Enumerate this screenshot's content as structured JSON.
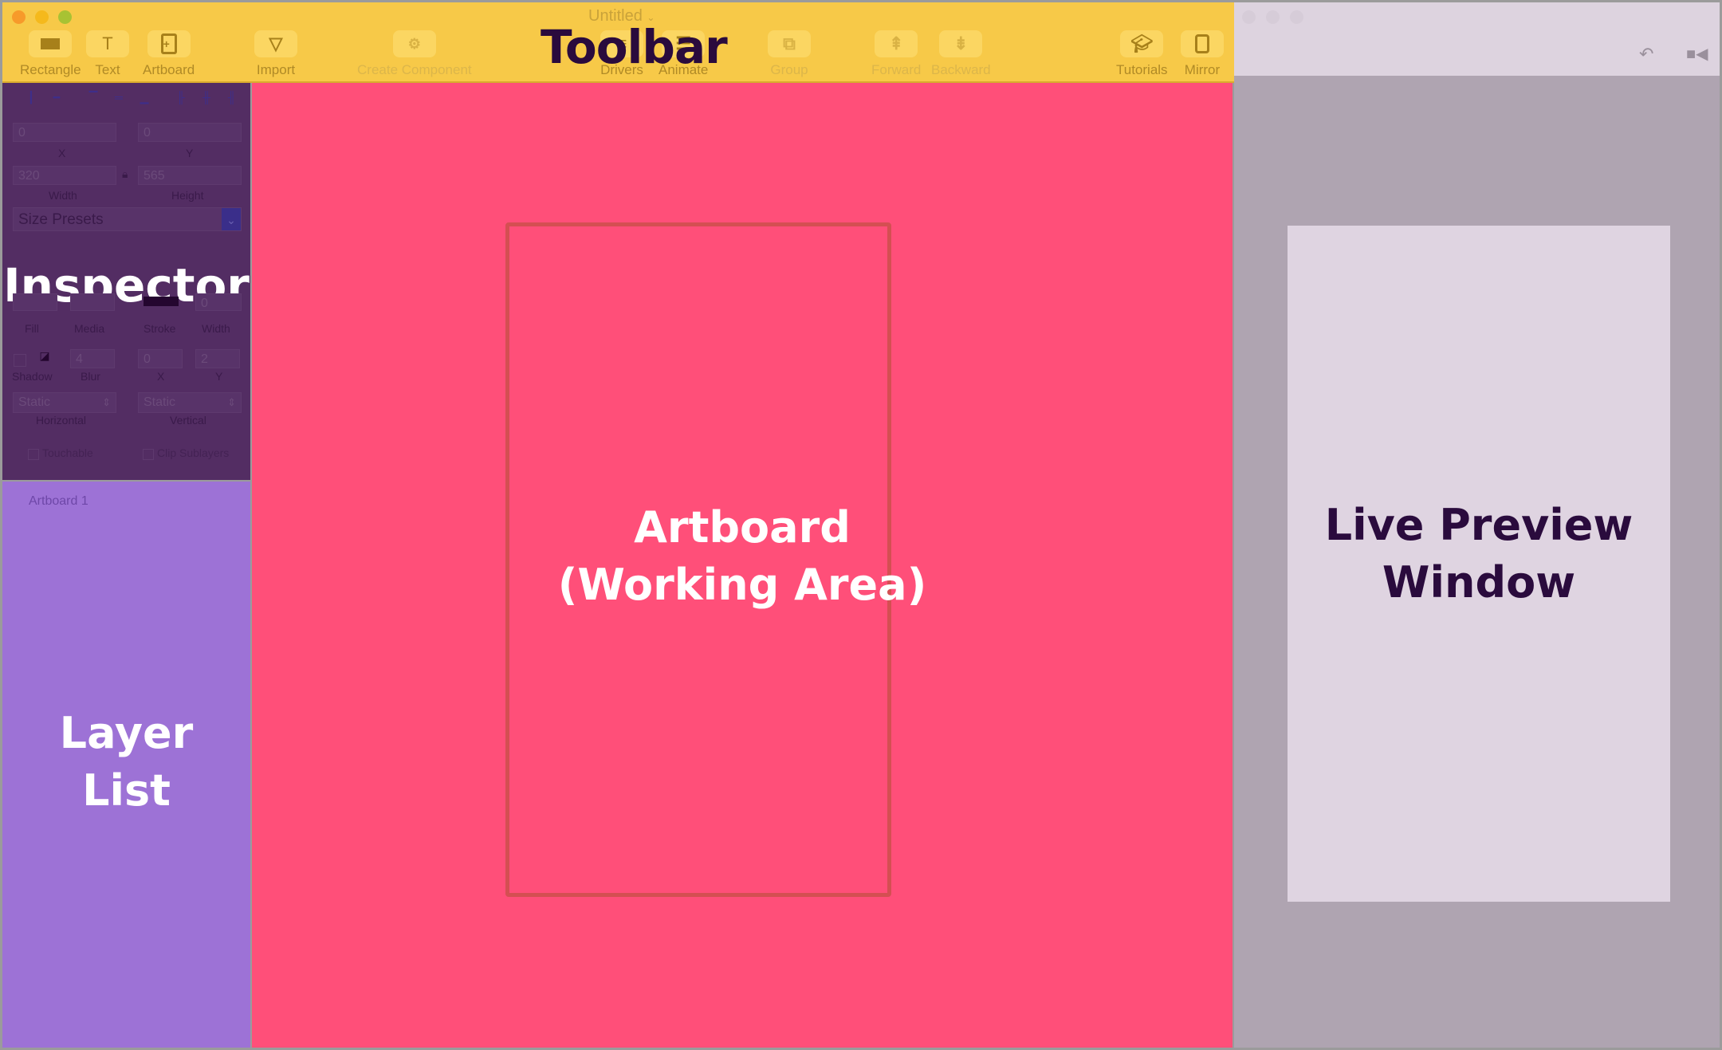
{
  "window": {
    "title": "Untitled"
  },
  "colors": {
    "toolbar": "#f7c948",
    "inspector": "#532d63",
    "layer_list": "#9d72d6",
    "canvas": "#ff4f79",
    "artboard_border": "#d44f52",
    "preview": "#afa4b1",
    "preview_card": "#dfd4e1"
  },
  "toolbar": {
    "tools": [
      {
        "label": "Rectangle",
        "icon": "rectangle-icon"
      },
      {
        "label": "Text",
        "icon": "text-icon"
      },
      {
        "label": "Artboard",
        "icon": "artboard-icon"
      },
      {
        "label": "Import",
        "icon": "import-icon"
      },
      {
        "label": "Create Component",
        "icon": "gears-icon"
      },
      {
        "label": "Drivers",
        "icon": "drivers-icon"
      },
      {
        "label": "Animate",
        "icon": "animate-icon"
      },
      {
        "label": "Group",
        "icon": "group-icon"
      },
      {
        "label": "Forward",
        "icon": "forward-icon"
      },
      {
        "label": "Backward",
        "icon": "backward-icon"
      },
      {
        "label": "Tutorials",
        "icon": "graduation-cap-icon"
      },
      {
        "label": "Mirror",
        "icon": "mirror-icon"
      }
    ]
  },
  "inspector": {
    "x_value": "0",
    "y_value": "0",
    "x_label": "X",
    "y_label": "Y",
    "width_value": "320",
    "height_value": "565",
    "width_label": "Width",
    "height_label": "Height",
    "size_presets": "Size Presets",
    "fill_label": "Fill",
    "media_label": "Media",
    "stroke_label": "Stroke",
    "stroke_width_label": "Width",
    "stroke_width_value": "0",
    "shadow_label": "Shadow",
    "blur_label": "Blur",
    "blur_value": "4",
    "shadow_x_label": "X",
    "shadow_x_value": "0",
    "shadow_y_label": "Y",
    "shadow_y_value": "2",
    "horizontal_value": "Static",
    "horizontal_label": "Horizontal",
    "vertical_value": "Static",
    "vertical_label": "Vertical",
    "touchable_label": "Touchable",
    "clip_label": "Clip Sublayers"
  },
  "layers": {
    "items": [
      "Artboard 1"
    ]
  },
  "annotations": {
    "toolbar": "Toolbar",
    "inspector": "Inspector",
    "layer_list_line1": "Layer",
    "layer_list_line2": "List",
    "artboard_line1": "Artboard",
    "artboard_line2": "(Working Area)",
    "preview_line1": "Live Preview",
    "preview_line2": "Window"
  }
}
